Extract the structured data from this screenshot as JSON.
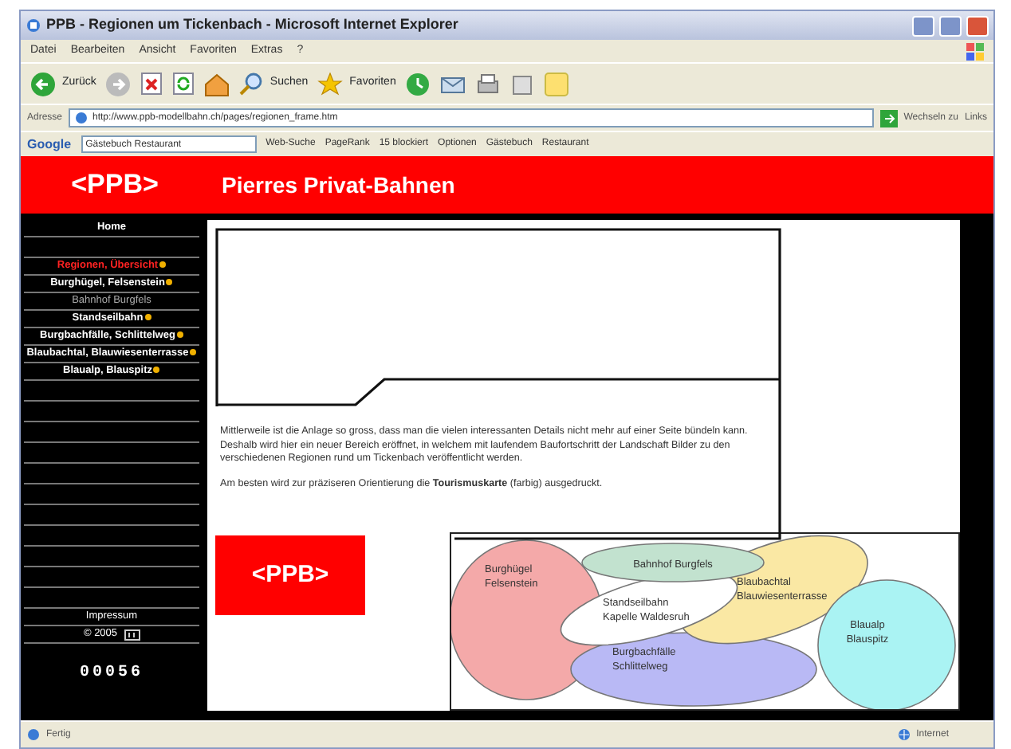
{
  "window": {
    "title": "PPB - Regionen um Tickenbach - Microsoft Internet Explorer"
  },
  "menu": [
    "Datei",
    "Bearbeiten",
    "Ansicht",
    "Favoriten",
    "Extras",
    "?"
  ],
  "toolbar": {
    "back": "Zurück",
    "search": "Suchen",
    "favorites": "Favoriten"
  },
  "address_bar": {
    "label": "Adresse",
    "url": "http://www.ppb-modellbahn.ch/pages/regionen_frame.htm",
    "go": "Wechseln zu",
    "links": "Links"
  },
  "google_bar": {
    "logo": "Google",
    "query": "Gästebuch Restaurant",
    "items": [
      "Web-Suche",
      "PageRank",
      "15 blockiert",
      "Optionen",
      "Gästebuch",
      "Restaurant"
    ]
  },
  "header": {
    "logo": "<PPB>",
    "title": "Pierres Privat-Bahnen"
  },
  "sidebar": {
    "items": [
      {
        "label": "Home",
        "kind": "main",
        "selected": false
      },
      {
        "label": "Regionen, Übersicht",
        "kind": "main",
        "selected": true
      },
      {
        "label": "Burghügel, Felsenstein",
        "kind": "main",
        "selected": false
      },
      {
        "label": "Bahnhof Burgfels",
        "kind": "sub",
        "selected": false
      },
      {
        "label": "Standseilbahn",
        "kind": "main",
        "selected": false
      },
      {
        "label": "Burgbachfälle, Schlittelweg",
        "kind": "main",
        "selected": false
      },
      {
        "label": "Blaubachtal, Blauwiesenterrasse",
        "kind": "main",
        "selected": false
      },
      {
        "label": "Blaualp, Blauspitz",
        "kind": "main",
        "selected": false
      }
    ],
    "impressum": "Impressum",
    "copyright": "© 2005",
    "counter": "00056"
  },
  "content": {
    "paragraphs": [
      "Mittlerweile ist die Anlage so gross, dass man die vielen interessanten Details nicht mehr auf einer Seite bündeln kann. Deshalb wird hier ein neuer Bereich eröffnet, in welchem mit laufendem Baufortschritt der Landschaft Bilder zu den verschiedenen Regionen rund um Tickenbach veröffentlicht werden.",
      "Am besten wird zur präziseren Orientierung die **Tourismuskarte** (farbig) ausgedruckt."
    ],
    "logo": "<PPB>"
  },
  "map": {
    "regions": [
      {
        "lines": [
          "Bahnhof Burgfels"
        ],
        "color": "#c2e2cf"
      },
      {
        "lines": [
          "Burghügel",
          "Felsenstein"
        ],
        "color": "#f4a9a9"
      },
      {
        "lines": [
          "Blaubachtal",
          "Blauwiesenterrasse"
        ],
        "color": "#fae8a4"
      },
      {
        "lines": [
          "Standseilbahn",
          "Kapelle Waldesruh"
        ],
        "color": "#ffffff"
      },
      {
        "lines": [
          "Blaualp",
          "Blauspitz"
        ],
        "color": "#aaf3f3"
      },
      {
        "lines": [
          "Burgbachfälle",
          "Schlittelweg"
        ],
        "color": "#b9b9f5"
      }
    ]
  },
  "status_bar": {
    "left": "Fertig",
    "right": "Internet"
  }
}
